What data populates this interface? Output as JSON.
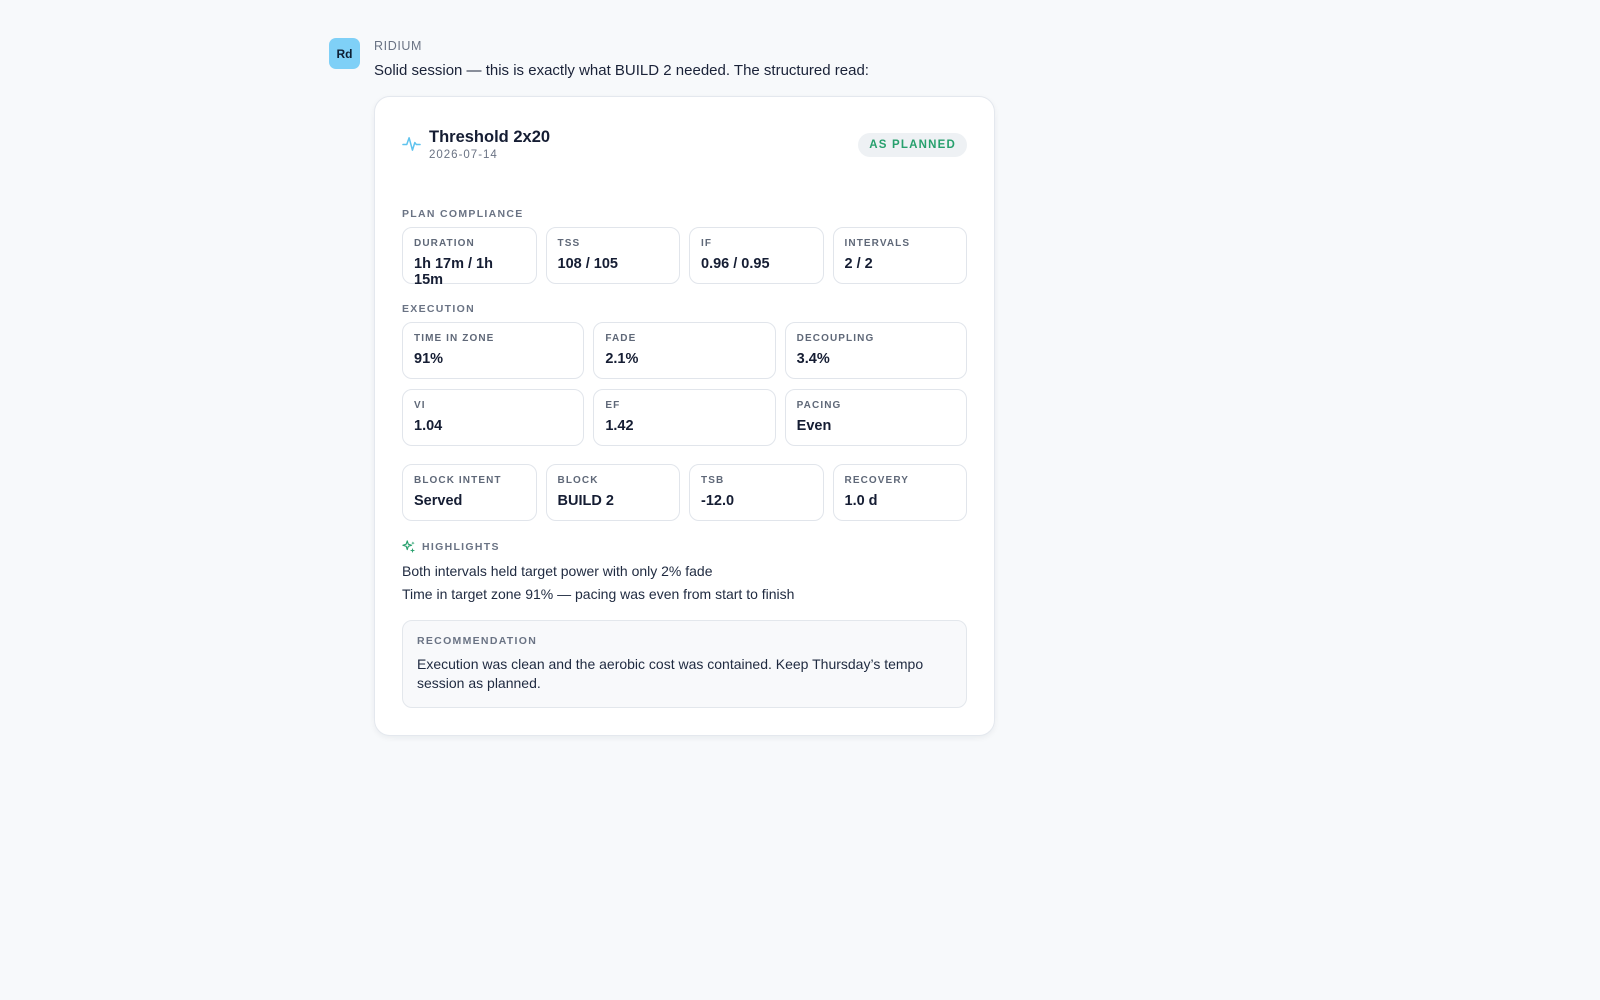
{
  "message": {
    "avatar_initials": "Rd",
    "sender": "RIDIUM",
    "text": "Solid session — this is exactly what BUILD 2 needed. The structured read:"
  },
  "card": {
    "icon": "pulse-icon",
    "title": "Threshold 2x20",
    "date": "2026-07-14",
    "badge": "AS PLANNED",
    "colors": {
      "accent": "#7fd0f7",
      "badge_text": "#27a06d",
      "badge_bg": "#eef1f4"
    },
    "plan_compliance": {
      "label": "PLAN COMPLIANCE",
      "tiles": [
        {
          "label": "DURATION",
          "value": "1h 17m / 1h 15m"
        },
        {
          "label": "TSS",
          "value": "108 / 105"
        },
        {
          "label": "IF",
          "value": "0.96 / 0.95"
        },
        {
          "label": "INTERVALS",
          "value": "2 / 2"
        }
      ]
    },
    "execution": {
      "label": "EXECUTION",
      "tiles": [
        {
          "label": "TIME IN ZONE",
          "value": "91%"
        },
        {
          "label": "FADE",
          "value": "2.1%"
        },
        {
          "label": "DECOUPLING",
          "value": "3.4%"
        },
        {
          "label": "VI",
          "value": "1.04"
        },
        {
          "label": "EF",
          "value": "1.42"
        },
        {
          "label": "PACING",
          "value": "Even"
        }
      ]
    },
    "block": {
      "tiles": [
        {
          "label": "BLOCK INTENT",
          "value": "Served"
        },
        {
          "label": "BLOCK",
          "value": "BUILD 2"
        },
        {
          "label": "TSB",
          "value": "-12.0"
        },
        {
          "label": "RECOVERY",
          "value": "1.0 d"
        }
      ]
    },
    "highlights": {
      "icon": "sparkle-icon",
      "label": "HIGHLIGHTS",
      "items": [
        "Both intervals held target power with only 2% fade",
        "Time in target zone 91% — pacing was even from start to finish"
      ]
    },
    "recommendation": {
      "label": "RECOMMENDATION",
      "text": "Execution was clean and the aerobic cost was contained. Keep Thursday’s tempo session as planned."
    }
  }
}
